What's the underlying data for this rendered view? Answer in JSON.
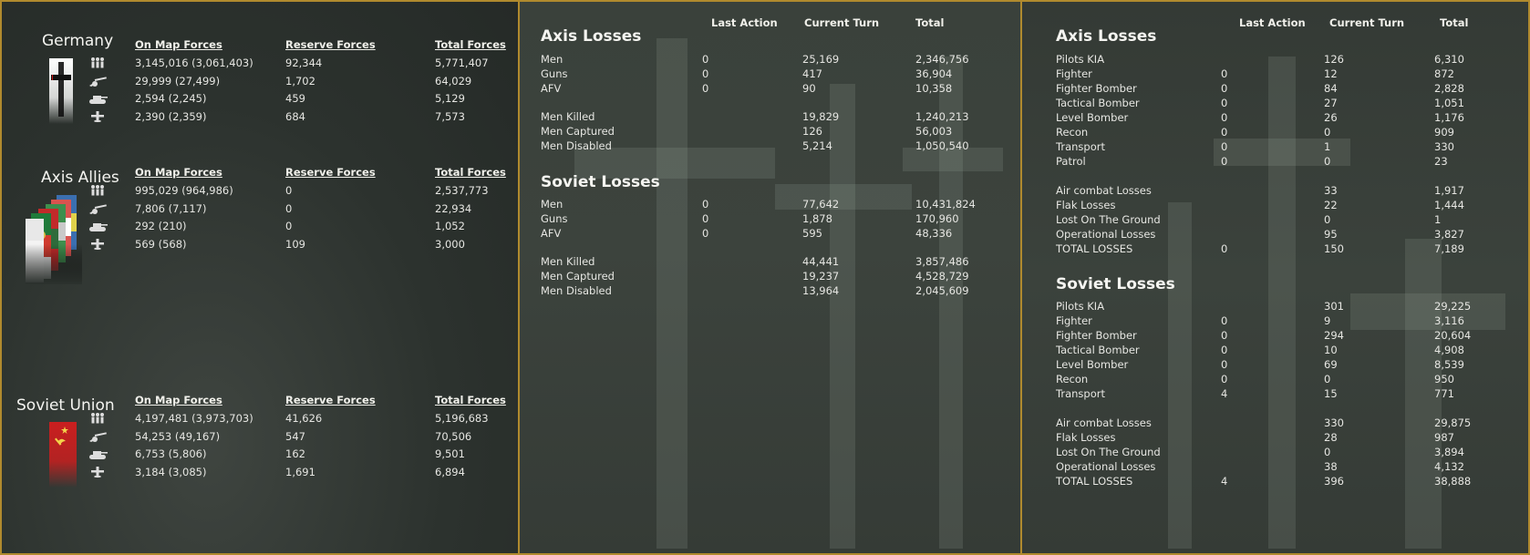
{
  "forces": {
    "headers": {
      "on_map": "On Map Forces",
      "reserve": "Reserve Forces",
      "total": "Total Forces"
    },
    "nations": [
      {
        "name": "Germany",
        "flag": "german-war-flag",
        "rows": [
          {
            "icon": "men-icon",
            "on_map": "3,145,016 (3,061,403)",
            "reserve": "92,344",
            "total": "5,771,407"
          },
          {
            "icon": "gun-icon",
            "on_map": "29,999 (27,499)",
            "reserve": "1,702",
            "total": "64,029"
          },
          {
            "icon": "tank-icon",
            "on_map": "2,594 (2,245)",
            "reserve": "459",
            "total": "5,129"
          },
          {
            "icon": "plane-icon",
            "on_map": "2,390 (2,359)",
            "reserve": "684",
            "total": "7,573"
          }
        ]
      },
      {
        "name": "Axis Allies",
        "flag": "axis-allies-flags",
        "rows": [
          {
            "icon": "men-icon",
            "on_map": "995,029 (964,986)",
            "reserve": "0",
            "total": "2,537,773"
          },
          {
            "icon": "gun-icon",
            "on_map": "7,806 (7,117)",
            "reserve": "0",
            "total": "22,934"
          },
          {
            "icon": "tank-icon",
            "on_map": "292 (210)",
            "reserve": "0",
            "total": "1,052"
          },
          {
            "icon": "plane-icon",
            "on_map": "569 (568)",
            "reserve": "109",
            "total": "3,000"
          }
        ]
      },
      {
        "name": "Soviet Union",
        "flag": "soviet-flag",
        "rows": [
          {
            "icon": "men-icon",
            "on_map": "4,197,481 (3,973,703)",
            "reserve": "41,626",
            "total": "5,196,683"
          },
          {
            "icon": "gun-icon",
            "on_map": "54,253 (49,167)",
            "reserve": "547",
            "total": "70,506"
          },
          {
            "icon": "tank-icon",
            "on_map": "6,753 (5,806)",
            "reserve": "162",
            "total": "9,501"
          },
          {
            "icon": "plane-icon",
            "on_map": "3,184 (3,085)",
            "reserve": "1,691",
            "total": "6,894"
          }
        ]
      }
    ]
  },
  "ground_losses": {
    "headers": {
      "last": "Last Action",
      "current": "Current Turn",
      "total": "Total"
    },
    "sections": [
      {
        "title": "Axis Losses",
        "rows": [
          {
            "label": "Men",
            "last": "0",
            "current": "25,169",
            "total": "2,346,756"
          },
          {
            "label": "Guns",
            "last": "0",
            "current": "417",
            "total": "36,904"
          },
          {
            "label": "AFV",
            "last": "0",
            "current": "90",
            "total": "10,358"
          },
          {
            "label": "Men Killed",
            "last": "",
            "current": "19,829",
            "total": "1,240,213"
          },
          {
            "label": "Men Captured",
            "last": "",
            "current": "126",
            "total": "56,003"
          },
          {
            "label": "Men Disabled",
            "last": "",
            "current": "5,214",
            "total": "1,050,540"
          }
        ]
      },
      {
        "title": "Soviet Losses",
        "rows": [
          {
            "label": "Men",
            "last": "0",
            "current": "77,642",
            "total": "10,431,824"
          },
          {
            "label": "Guns",
            "last": "0",
            "current": "1,878",
            "total": "170,960"
          },
          {
            "label": "AFV",
            "last": "0",
            "current": "595",
            "total": "48,336"
          },
          {
            "label": "Men Killed",
            "last": "",
            "current": "44,441",
            "total": "3,857,486"
          },
          {
            "label": "Men Captured",
            "last": "",
            "current": "19,237",
            "total": "4,528,729"
          },
          {
            "label": "Men Disabled",
            "last": "",
            "current": "13,964",
            "total": "2,045,609"
          }
        ]
      }
    ]
  },
  "air_losses": {
    "headers": {
      "last": "Last Action",
      "current": "Current Turn",
      "total": "Total"
    },
    "sections": [
      {
        "title": "Axis Losses",
        "rows": [
          {
            "label": "Pilots KIA",
            "last": "",
            "current": "126",
            "total": "6,310"
          },
          {
            "label": "Fighter",
            "last": "0",
            "current": "12",
            "total": "872"
          },
          {
            "label": "Fighter Bomber",
            "last": "0",
            "current": "84",
            "total": "2,828"
          },
          {
            "label": "Tactical Bomber",
            "last": "0",
            "current": "27",
            "total": "1,051"
          },
          {
            "label": "Level Bomber",
            "last": "0",
            "current": "26",
            "total": "1,176"
          },
          {
            "label": "Recon",
            "last": "0",
            "current": "0",
            "total": "909"
          },
          {
            "label": "Transport",
            "last": "0",
            "current": "1",
            "total": "330"
          },
          {
            "label": "Patrol",
            "last": "0",
            "current": "0",
            "total": "23"
          },
          {
            "label": "Air combat Losses",
            "last": "",
            "current": "33",
            "total": "1,917"
          },
          {
            "label": "Flak Losses",
            "last": "",
            "current": "22",
            "total": "1,444"
          },
          {
            "label": "Lost On The Ground",
            "last": "",
            "current": "0",
            "total": "1"
          },
          {
            "label": "Operational Losses",
            "last": "",
            "current": "95",
            "total": "3,827"
          },
          {
            "label": "TOTAL LOSSES",
            "last": "0",
            "current": "150",
            "total": "7,189"
          }
        ]
      },
      {
        "title": "Soviet Losses",
        "rows": [
          {
            "label": "Pilots KIA",
            "last": "",
            "current": "301",
            "total": "29,225"
          },
          {
            "label": "Fighter",
            "last": "0",
            "current": "9",
            "total": "3,116"
          },
          {
            "label": "Fighter Bomber",
            "last": "0",
            "current": "294",
            "total": "20,604"
          },
          {
            "label": "Tactical Bomber",
            "last": "0",
            "current": "10",
            "total": "4,908"
          },
          {
            "label": "Level Bomber",
            "last": "0",
            "current": "69",
            "total": "8,539"
          },
          {
            "label": "Recon",
            "last": "0",
            "current": "0",
            "total": "950"
          },
          {
            "label": "Transport",
            "last": "4",
            "current": "15",
            "total": "771"
          },
          {
            "label": "Air combat Losses",
            "last": "",
            "current": "330",
            "total": "29,875"
          },
          {
            "label": "Flak Losses",
            "last": "",
            "current": "28",
            "total": "987"
          },
          {
            "label": "Lost On The Ground",
            "last": "",
            "current": "0",
            "total": "3,894"
          },
          {
            "label": "Operational Losses",
            "last": "",
            "current": "38",
            "total": "4,132"
          },
          {
            "label": "TOTAL LOSSES",
            "last": "4",
            "current": "396",
            "total": "38,888"
          }
        ]
      }
    ]
  },
  "colors": {
    "border": "#b08a2e",
    "panel": "#2f3530",
    "text": "#e6e6e2"
  }
}
